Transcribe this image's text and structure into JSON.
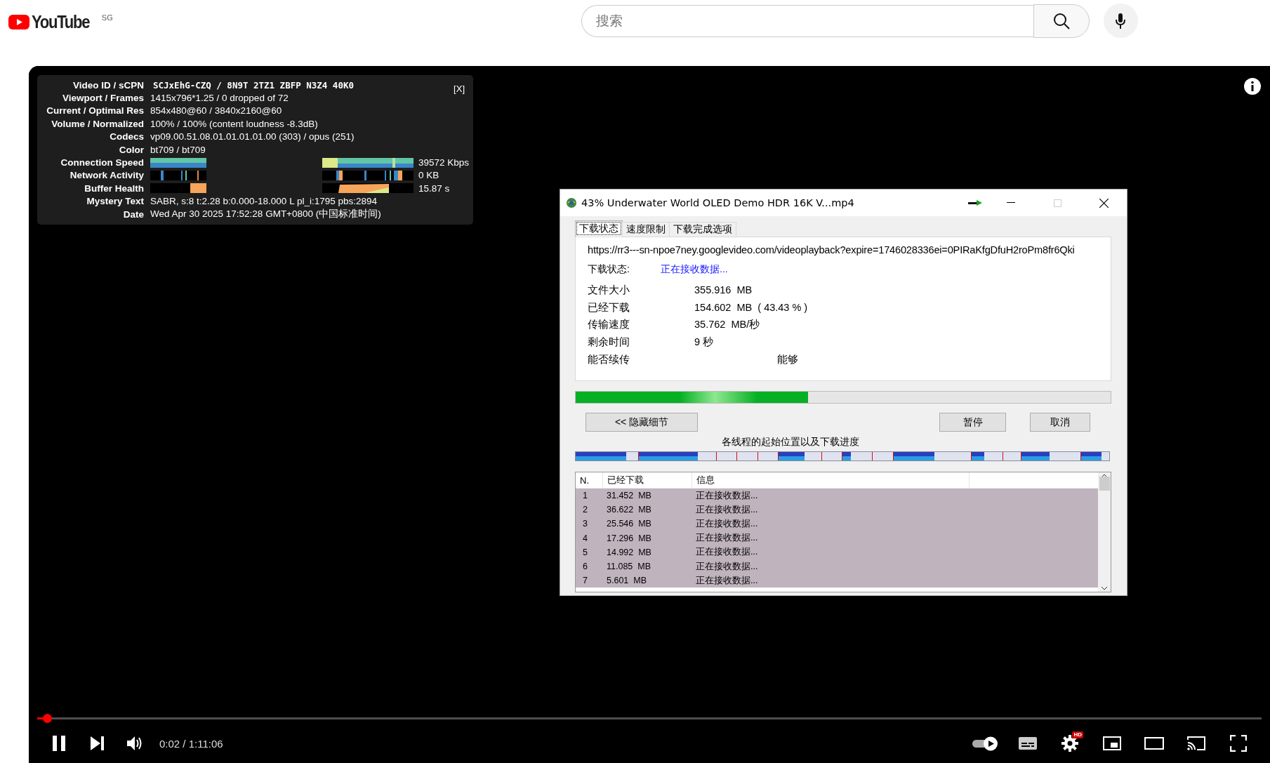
{
  "header": {
    "logo_text": "YouTube",
    "region": "SG",
    "search": {
      "placeholder": "搜索"
    }
  },
  "player": {
    "stats": {
      "close": "[X]",
      "rows": [
        {
          "label": "Video ID / sCPN",
          "kind": "mono",
          "value": "SCJxEhG-CZQ / 8N9T 2TZ1 ZBFP N3Z4 40K0"
        },
        {
          "label": "Viewport / Frames",
          "kind": "text",
          "value": "1415x796*1.25 / 0 dropped of 72"
        },
        {
          "label": "Current / Optimal Res",
          "kind": "text",
          "value": "854x480@60 / 3840x2160@60"
        },
        {
          "label": "Volume / Normalized",
          "kind": "text",
          "value": "100% / 100% (content loudness -8.3dB)"
        },
        {
          "label": "Codecs",
          "kind": "text",
          "value": "vp09.00.51.08.01.01.01.01.00 (303) / opus (251)"
        },
        {
          "label": "Color",
          "kind": "text",
          "value": "bt709 / bt709"
        },
        {
          "label": "Connection Speed",
          "kind": "speed_graph",
          "value": "39572 Kbps"
        },
        {
          "label": "Network Activity",
          "kind": "activity_graph",
          "value": "0 KB"
        },
        {
          "label": "Buffer Health",
          "kind": "buffer_graph",
          "value": "15.87 s"
        },
        {
          "label": "Mystery Text",
          "kind": "text",
          "value": "SABR, s:8 t:2.28 b:0.000-18.000 L pl_i:1795 pbs:2894"
        },
        {
          "label": "Date",
          "kind": "text",
          "value": "Wed Apr 30 2025 17:52:28 GMT+0800 (中国标准时间)"
        }
      ]
    },
    "progress": {
      "level": 0.008
    },
    "time": "0:02 / 1:11:06",
    "autoplay": {
      "on": true
    },
    "settings_badge": "HD"
  },
  "dialog": {
    "title": "43% Underwater World OLED Demo HDR 16K V...mp4",
    "tabs": [
      {
        "label": "下载状态",
        "selected": true
      },
      {
        "label": "速度限制",
        "selected": false
      },
      {
        "label": "下载完成选项",
        "selected": false
      }
    ],
    "url": "https://rr3---sn-npoe7ney.googlevideo.com/videoplayback?expire=1746028336ei=0PIRaKfgDfuH2roPm8fr6Qki",
    "status": {
      "label": "下载状态:",
      "value": "正在接收数据..."
    },
    "info": [
      {
        "label": "文件大小",
        "value": "355.916  MB",
        "kind": "plain"
      },
      {
        "label": "已经下载",
        "value": "154.602  MB  ( 43.43 % )",
        "kind": "plain"
      },
      {
        "label": "传输速度",
        "value": "35.762  MB/秒",
        "kind": "plain"
      },
      {
        "label": "剩余时间",
        "value": "9 秒",
        "kind": "plain"
      },
      {
        "label": "能否续传",
        "value": "能够",
        "kind": "offset"
      }
    ],
    "progress": {
      "level": 0.4343
    },
    "buttons": [
      {
        "label": "<< 隐藏细节",
        "kind": "details"
      },
      {
        "label": "暂停",
        "kind": "action"
      },
      {
        "label": "取消",
        "kind": "action"
      }
    ],
    "threads_caption": "各线程的起始位置以及下载进度",
    "table": {
      "columns": [
        "N.",
        "已经下载",
        "信息"
      ],
      "rows": [
        {
          "n": "1",
          "downloaded": "31.452  MB",
          "info": "正在接收数据...",
          "selected": true
        },
        {
          "n": "2",
          "downloaded": "36.622  MB",
          "info": "正在接收数据...",
          "selected": true
        },
        {
          "n": "3",
          "downloaded": "25.546  MB",
          "info": "正在接收数据...",
          "selected": true
        },
        {
          "n": "4",
          "downloaded": "17.296  MB",
          "info": "正在接收数据...",
          "selected": true
        },
        {
          "n": "5",
          "downloaded": "14.992  MB",
          "info": "正在接收数据...",
          "selected": true
        },
        {
          "n": "6",
          "downloaded": "11.085  MB",
          "info": "正在接收数据...",
          "selected": true
        },
        {
          "n": "7",
          "downloaded": "5.601  MB",
          "info": "正在接收数据...",
          "selected": true
        }
      ]
    }
  }
}
